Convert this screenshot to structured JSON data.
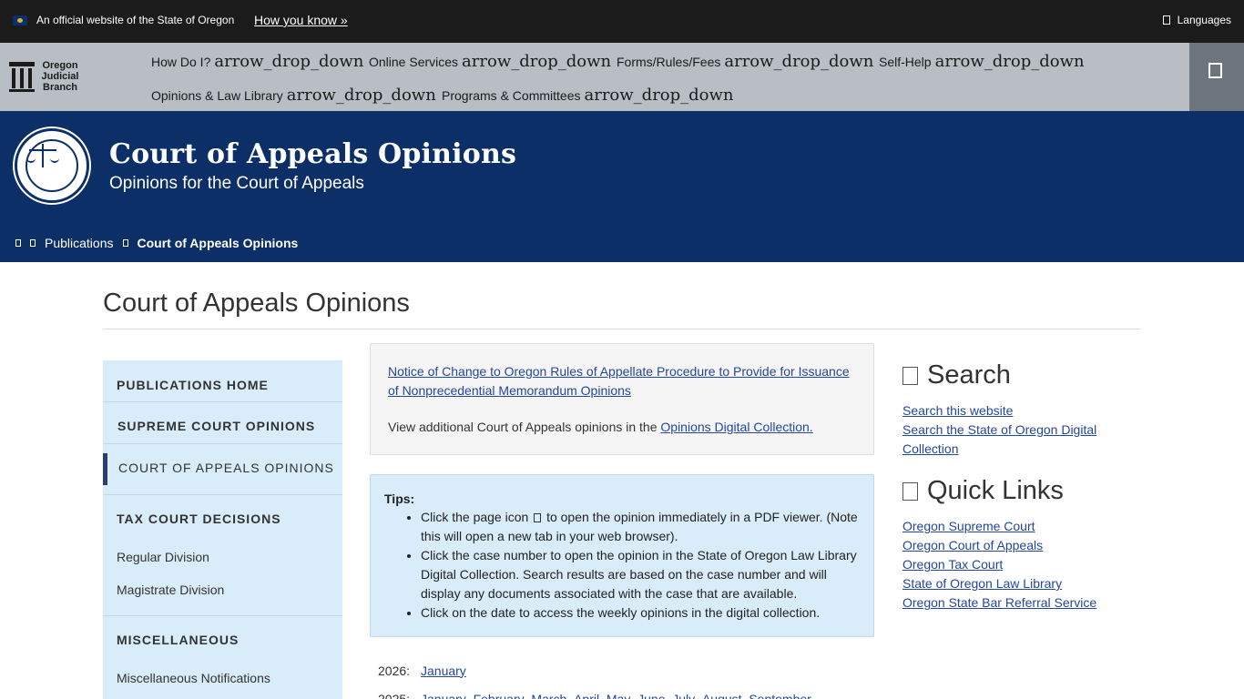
{
  "official_bar": {
    "text": "An official website of the State of Oregon",
    "how_link": "How you know »",
    "languages": "Languages"
  },
  "logo": {
    "line1": "Oregon",
    "line2": "Judicial",
    "line3": "Branch"
  },
  "nav": {
    "arrow_text": "arrow_drop_down",
    "items": [
      {
        "label": "How Do I?"
      },
      {
        "label": "Online Services"
      },
      {
        "label": "Forms/Rules/Fees"
      },
      {
        "label": "Self-Help"
      },
      {
        "label": "Opinions & Law Library"
      },
      {
        "label": "Programs & Committees"
      }
    ]
  },
  "banner": {
    "title": "Court of Appeals Opinions",
    "subtitle": "Opinions for the Court of Appeals"
  },
  "breadcrumb": {
    "publications": "Publications",
    "current": "Court of Appeals Opinions"
  },
  "page": {
    "title": "Court of Appeals Opinions"
  },
  "sidebar": {
    "publications_home": "PUBLICATIONS HOME",
    "supreme_court": "SUPREME COURT OPINIONS",
    "court_of_appeals": "COURT OF APPEALS OPINIONS",
    "tax_court": "TAX COURT DECISIONS",
    "regular_division": "Regular Division",
    "magistrate_division": "Magistrate Division",
    "miscellaneous": "MISCELLANEOUS",
    "misc_notifications": "Miscellaneous Notifications"
  },
  "notice": {
    "link": "Notice of Change to Oregon Rules of Appellate Procedure to Provide for Issuance of Nonprecedential Memorandum Opinions",
    "text_prefix": "View additional Court of Appeals opinions in the",
    "text_link": "Opinions Digital Collection."
  },
  "tips": {
    "title": "Tips:",
    "tip1_a": "Click the page icon",
    "tip1_b": "to open the opinion immediately in a PDF viewer. (Note this will open a new tab in your web browser).",
    "tip2": "Click the case number to open the opinion in the State of Oregon Law Library Digital Collection. Search results are based on the case number and will display any documents associated with the case that are available.",
    "tip3": "Click on the date to access the weekly opinions in the digital collection."
  },
  "years": [
    {
      "year": "2026:",
      "months": [
        "January"
      ]
    },
    {
      "year": "2025:",
      "months": [
        "January",
        "February",
        "March",
        "April",
        "May",
        "June",
        "July",
        "August",
        "September"
      ]
    }
  ],
  "search": {
    "heading": "Search",
    "link1": "Search this website",
    "link2": "Search the State of Oregon Digital Collection"
  },
  "quick_links": {
    "heading": "Quick Links",
    "items": [
      "Oregon Supreme Court",
      "Oregon Court of Appeals",
      "Oregon Tax Court",
      "State of Oregon Law Library",
      "Oregon State Bar Referral Service"
    ]
  }
}
